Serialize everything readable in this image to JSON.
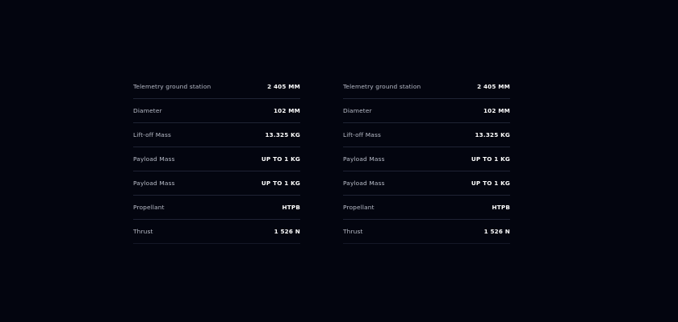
{
  "spec_tables": [
    {
      "rows": [
        {
          "label": "Telemetry ground station",
          "value": "2 405 MM"
        },
        {
          "label": "Diameter",
          "value": "102 MM"
        },
        {
          "label": "Lift-off Mass",
          "value": "13.325 KG"
        },
        {
          "label": "Payload Mass",
          "value": "UP TO 1 KG"
        },
        {
          "label": "Payload Mass",
          "value": "UP TO 1 KG"
        },
        {
          "label": "Propellant",
          "value": "HTPB"
        },
        {
          "label": "Thrust",
          "value": "1 526 N"
        }
      ]
    },
    {
      "rows": [
        {
          "label": "Telemetry ground station",
          "value": "2 405 MM"
        },
        {
          "label": "Diameter",
          "value": "102 MM"
        },
        {
          "label": "Lift-off Mass",
          "value": "13.325 KG"
        },
        {
          "label": "Payload Mass",
          "value": "UP TO 1 KG"
        },
        {
          "label": "Payload Mass",
          "value": "UP TO 1 KG"
        },
        {
          "label": "Propellant",
          "value": "HTPB"
        },
        {
          "label": "Thrust",
          "value": "1 526 N"
        }
      ]
    }
  ],
  "colors": {
    "background": "#03050f",
    "label": "#b9bdc9",
    "value": "#ffffff",
    "divider": "#1f2334"
  }
}
